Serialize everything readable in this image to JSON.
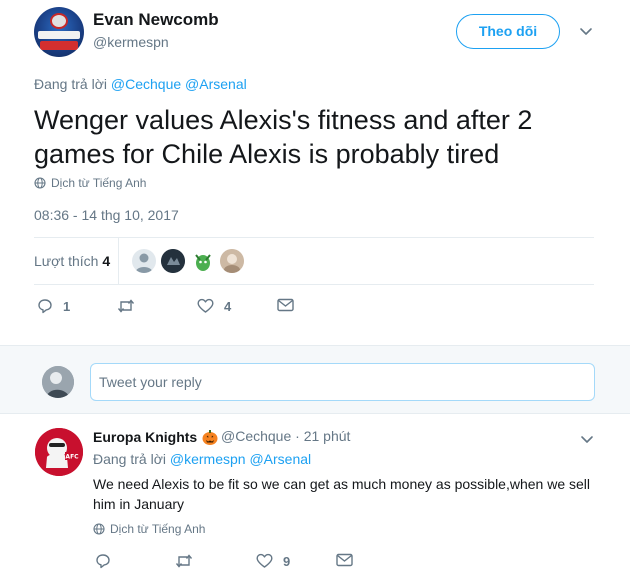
{
  "main_tweet": {
    "author_name": "Evan Newcomb",
    "author_handle": "@kermespn",
    "follow_label": "Theo dõi",
    "reply_prefix": "Đang trả lời",
    "reply_mentions": [
      "@Cechque",
      "@Arsenal"
    ],
    "text": "Wenger values Alexis's fitness and after 2 games for Chile Alexis is probably tired",
    "translate_label": "Dịch từ Tiếng Anh",
    "timestamp": "08:36 - 14 thg 10, 2017",
    "likes_label": "Lượt thích",
    "likes_count": "4",
    "likers": [
      "default-avatar",
      "dark-avatar",
      "green-avatar",
      "photo-avatar"
    ],
    "actions": {
      "reply_count": "1",
      "retweet_count": "",
      "like_count": "4"
    }
  },
  "composer": {
    "placeholder": "Tweet your reply"
  },
  "reply_tweet": {
    "author_name": "Europa Knights",
    "emoji": "jack-o-lantern",
    "author_handle": "@Cechque",
    "separator": "·",
    "time_ago": "21 phút",
    "reply_prefix": "Đang trả lời",
    "reply_mentions": [
      "@kermespn",
      "@Arsenal"
    ],
    "text": "We need Alexis to be fit so we can get as much money as possible,when we sell him in January",
    "translate_label": "Dịch từ Tiếng Anh",
    "actions": {
      "reply_count": "",
      "retweet_count": "",
      "like_count": "9"
    }
  },
  "colors": {
    "accent": "#1da1f2",
    "secondary_text": "#657786",
    "primary_text": "#14171a",
    "divider": "#e6ecf0",
    "composer_bg": "#f5f8fa"
  }
}
